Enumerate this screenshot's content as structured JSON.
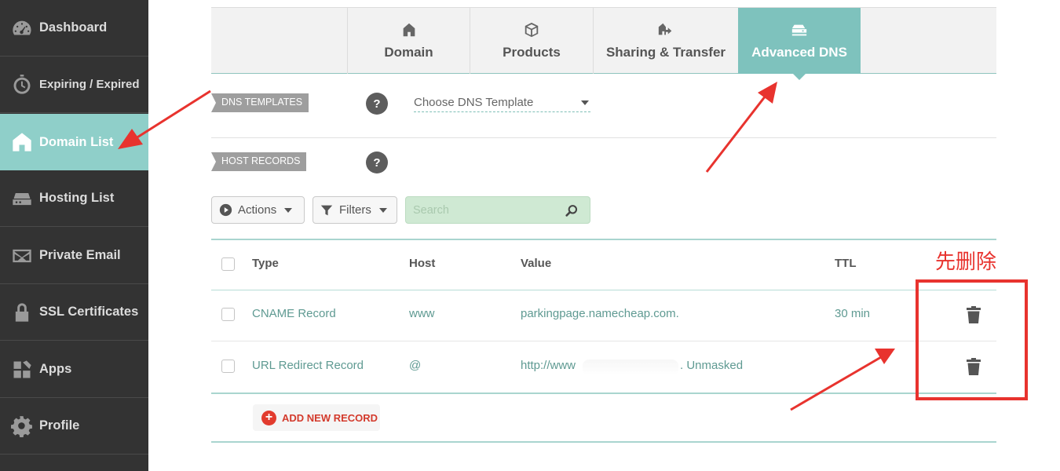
{
  "sidebar": {
    "items": [
      {
        "label": "Dashboard",
        "icon": "speedometer-icon"
      },
      {
        "label": "Expiring / Expired",
        "icon": "stopwatch-icon"
      },
      {
        "label": "Domain List",
        "icon": "home-icon",
        "active": true
      },
      {
        "label": "Hosting List",
        "icon": "server-icon"
      },
      {
        "label": "Private Email",
        "icon": "envelope-icon"
      },
      {
        "label": "SSL Certificates",
        "icon": "lock-icon"
      },
      {
        "label": "Apps",
        "icon": "apps-grid-icon"
      },
      {
        "label": "Profile",
        "icon": "gear-icon"
      }
    ]
  },
  "tabs": [
    {
      "label": "Domain",
      "icon": "house-icon"
    },
    {
      "label": "Products",
      "icon": "box-icon"
    },
    {
      "label": "Sharing & Transfer",
      "icon": "share-transfer-icon"
    },
    {
      "label": "Advanced DNS",
      "icon": "dns-server-icon",
      "active": true
    }
  ],
  "dns_templates": {
    "label": "DNS TEMPLATES",
    "help": "?",
    "select_value": "Choose DNS Template"
  },
  "host_records": {
    "label": "HOST RECORDS",
    "help": "?"
  },
  "toolbar": {
    "actions_label": "Actions",
    "filters_label": "Filters",
    "search_placeholder": "Search"
  },
  "table": {
    "headers": {
      "type": "Type",
      "host": "Host",
      "value": "Value",
      "ttl": "TTL"
    },
    "rows": [
      {
        "type": "CNAME Record",
        "host": "www",
        "value": "parkingpage.namecheap.com.",
        "ttl": "30 min"
      },
      {
        "type": "URL Redirect Record",
        "host": "@",
        "value_prefix": "http://www",
        "value_suffix": ". Unmasked",
        "ttl": ""
      }
    ]
  },
  "add_record_label": "ADD NEW RECORD",
  "annotation": {
    "note": "先删除",
    "color": "#e8332e"
  },
  "colors": {
    "sidebar_bg": "#333333",
    "accent": "#7ec2bd",
    "link": "#5f9a92",
    "danger": "#e23b2e"
  }
}
